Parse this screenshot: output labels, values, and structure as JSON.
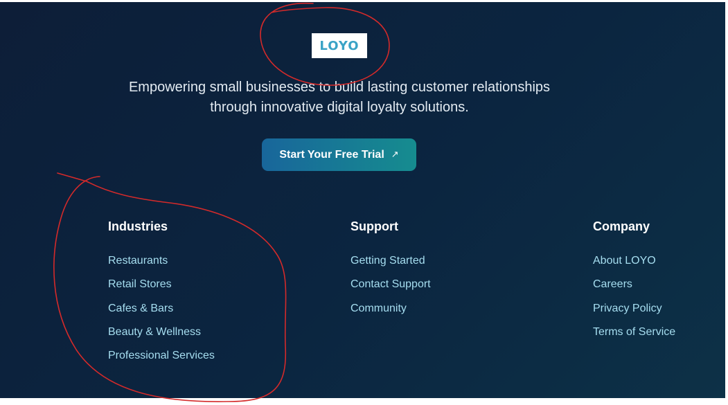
{
  "brand": {
    "logo_text": "LOYO",
    "logo_color": "#3aa3c6"
  },
  "hero": {
    "tagline_line1": "Empowering small businesses to build lasting customer relationships",
    "tagline_line2": "through innovative digital loyalty solutions.",
    "cta_label": "Start Your Free Trial",
    "cta_icon": "arrow-up-right-icon"
  },
  "columns": {
    "industries": {
      "title": "Industries",
      "links": [
        "Restaurants",
        "Retail Stores",
        "Cafes & Bars",
        "Beauty & Wellness",
        "Professional Services"
      ]
    },
    "support": {
      "title": "Support",
      "links": [
        "Getting Started",
        "Contact Support",
        "Community"
      ]
    },
    "company": {
      "title": "Company",
      "links": [
        "About LOYO",
        "Careers",
        "Privacy Policy",
        "Terms of Service"
      ]
    }
  },
  "colors": {
    "background": "#0b2540",
    "link": "#a6def0",
    "cta_start": "#18669b",
    "cta_end": "#168c8f",
    "annotation": "#d42a2a"
  },
  "annotations": [
    "logo-circle",
    "industries-circle"
  ]
}
